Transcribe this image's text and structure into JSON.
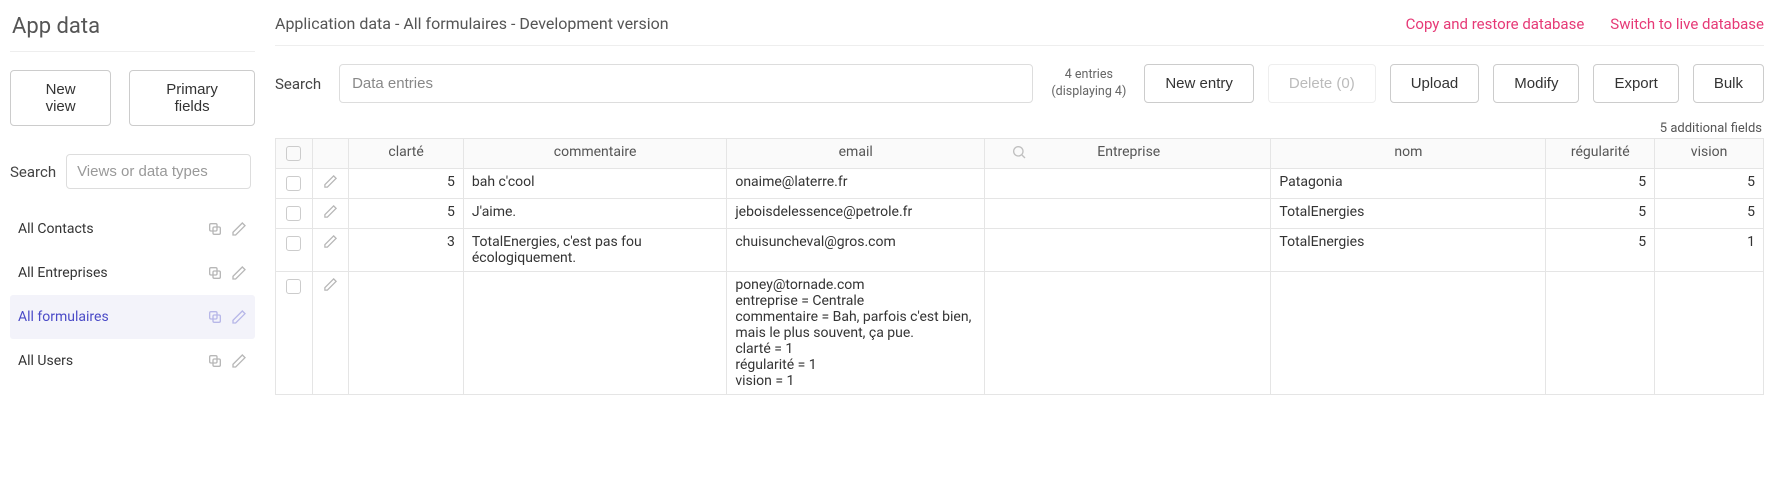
{
  "sidebar": {
    "title": "App data",
    "new_view": "New view",
    "primary_fields": "Primary fields",
    "search_label": "Search",
    "search_placeholder": "Views or data types",
    "views": [
      {
        "label": "All Contacts",
        "active": false
      },
      {
        "label": "All Entreprises",
        "active": false
      },
      {
        "label": "All formulaires",
        "active": true
      },
      {
        "label": "All Users",
        "active": false
      }
    ]
  },
  "header": {
    "breadcrumb": "Application data - All formulaires - Development version",
    "links": {
      "copy_restore": "Copy and restore database",
      "switch_live": "Switch to live database"
    }
  },
  "toolbar": {
    "search_label": "Search",
    "search_placeholder": "Data entries",
    "entries_line1": "4 entries",
    "entries_line2": "(displaying 4)",
    "new_entry": "New entry",
    "delete": "Delete (0)",
    "upload": "Upload",
    "modify": "Modify",
    "export": "Export",
    "bulk": "Bulk"
  },
  "table": {
    "additional_fields": "5 additional fields",
    "columns": {
      "clarte": "clarté",
      "commentaire": "commentaire",
      "email": "email",
      "entreprise": "Entreprise",
      "nom": "nom",
      "regularite": "régularité",
      "vision": "vision"
    },
    "rows": [
      {
        "clarte": "5",
        "commentaire": "bah c'cool",
        "email": "onaime@laterre.fr",
        "entreprise": "",
        "nom": "Patagonia",
        "regularite": "5",
        "vision": "5"
      },
      {
        "clarte": "5",
        "commentaire": "J'aime.",
        "email": "jeboisdelessence@petrole.fr",
        "entreprise": "",
        "nom": "TotalEnergies",
        "regularite": "5",
        "vision": "5"
      },
      {
        "clarte": "3",
        "commentaire": "TotalEnergies, c'est pas fou écologiquement.",
        "email": "chuisuncheval@gros.com",
        "entreprise": "",
        "nom": "TotalEnergies",
        "regularite": "5",
        "vision": "1"
      },
      {
        "clarte": "",
        "commentaire": "",
        "email": "poney@tornade.com\nentreprise = Centrale\ncommentaire = Bah, parfois c'est bien, mais le plus souvent, ça pue.\nclarté = 1\nrégularité = 1\nvision = 1",
        "entreprise": "",
        "nom": "",
        "regularite": "",
        "vision": ""
      }
    ]
  }
}
